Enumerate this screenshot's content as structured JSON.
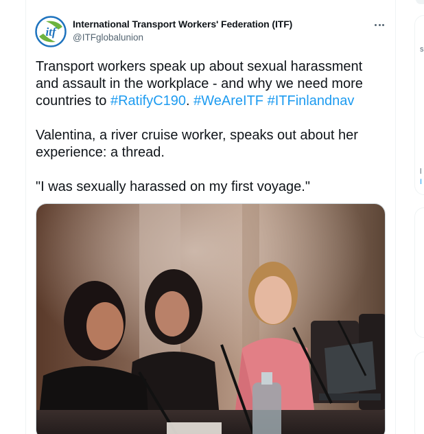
{
  "tweet": {
    "author_name": "International Transport Workers' Federation (ITF)",
    "author_handle": "@ITFglobalunion",
    "avatar_text": "itf",
    "more_label": "More",
    "text": {
      "line1": "Transport workers speak up about sexual harassment",
      "line2": "and assault in the workplace - and why we need more",
      "line3_prefix": "countries to ",
      "hashtag1": "#RatifyC190",
      "sep1": ". ",
      "hashtag2": "#WeAreITF",
      "sep2": " ",
      "hashtag3": "#ITFinlandnav",
      "line4": "Valentina, a river cruise worker, speaks out about her",
      "line5": "experience: a thread.",
      "line6": "\"I was sexually harassed on my first voyage.\""
    },
    "media_alt": "Three women seated at a conference table with microphones"
  },
  "sidebar_fragments": {
    "s": "s",
    "l": "l",
    "bar": "I"
  },
  "colors": {
    "link": "#1d9bf0",
    "text": "#0f1419",
    "secondary": "#536471",
    "brand_blue": "#1e73be",
    "brand_green": "#6db33f"
  }
}
